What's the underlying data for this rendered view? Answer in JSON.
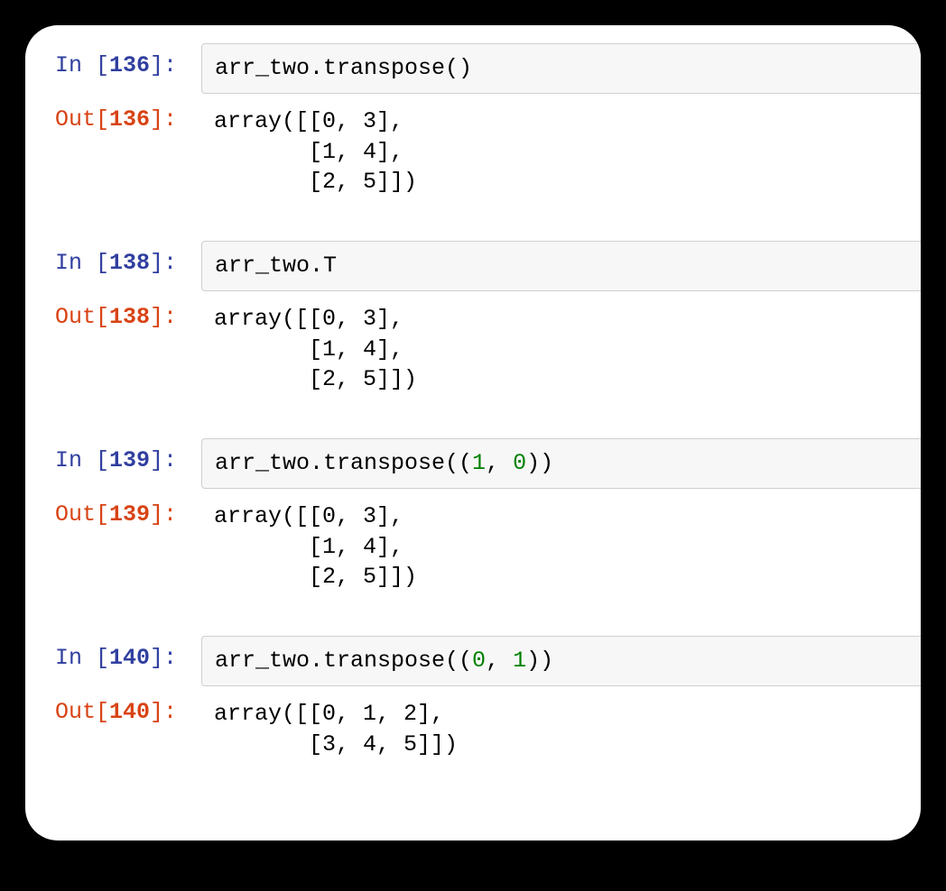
{
  "cells": [
    {
      "in_num": "136",
      "in_tokens": [
        [
          "",
          "arr_two.transpose()"
        ]
      ],
      "out_num": "136",
      "out_text": "array([[0, 3],\n       [1, 4],\n       [2, 5]])"
    },
    {
      "in_num": "138",
      "in_tokens": [
        [
          "",
          "arr_two.T"
        ]
      ],
      "out_num": "138",
      "out_text": "array([[0, 3],\n       [1, 4],\n       [2, 5]])"
    },
    {
      "in_num": "139",
      "in_tokens": [
        [
          "",
          "arr_two.transpose(("
        ],
        [
          "num",
          "1"
        ],
        [
          "",
          ", "
        ],
        [
          "num",
          "0"
        ],
        [
          "",
          "))"
        ]
      ],
      "out_num": "139",
      "out_text": "array([[0, 3],\n       [1, 4],\n       [2, 5]])"
    },
    {
      "in_num": "140",
      "in_tokens": [
        [
          "",
          "arr_two.transpose(("
        ],
        [
          "num",
          "0"
        ],
        [
          "",
          ", "
        ],
        [
          "num",
          "1"
        ],
        [
          "",
          "))"
        ]
      ],
      "out_num": "140",
      "out_text": "array([[0, 1, 2],\n       [3, 4, 5]])"
    }
  ],
  "labels": {
    "in_prefix": "In [",
    "in_suffix": "]: ",
    "out_prefix": "Out[",
    "out_suffix": "]: "
  }
}
